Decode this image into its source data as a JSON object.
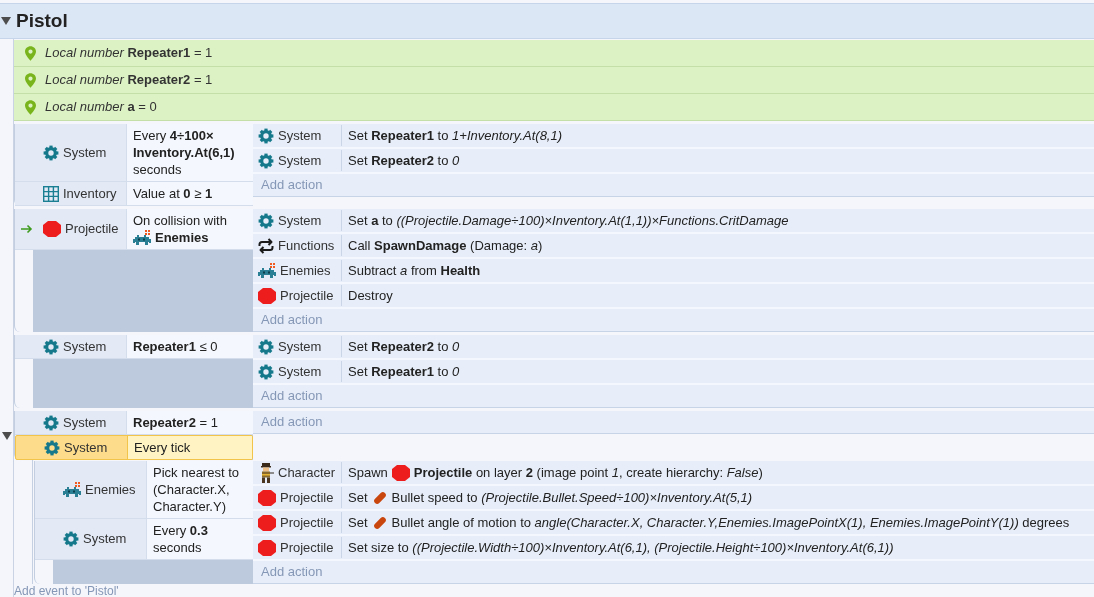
{
  "group": {
    "title": "Pistol",
    "expanded": true,
    "add_event_label": "Add event to 'Pistol'"
  },
  "local_variables": [
    {
      "text": "*Local number* **Repeater1** = 1"
    },
    {
      "text": "*Local number* **Repeater2** = 1"
    },
    {
      "text": "*Local number* **a** = 0"
    }
  ],
  "events": [
    {
      "conditions": [
        {
          "kind": "system",
          "object": "System",
          "trigger": false,
          "selected": false,
          "text": "Every **4÷100× Inventory.At(6,1)** seconds"
        },
        {
          "kind": "array",
          "object": "Inventory",
          "trigger": false,
          "selected": false,
          "text": "Value at **0** ≥ **1**"
        }
      ],
      "actions": [
        {
          "kind": "system",
          "object": "System",
          "text": "Set **Repeater1** to *1+Inventory.At(8,1)*"
        },
        {
          "kind": "system",
          "object": "System",
          "text": "Set **Repeater2** to *0*"
        }
      ],
      "add_action_label": "Add action"
    },
    {
      "conditions": [
        {
          "kind": "projectile",
          "object": "Projectile",
          "trigger": true,
          "selected": false,
          "parts": [
            {
              "kind": "text",
              "text": "On collision with"
            },
            {
              "kind": "enemy"
            },
            {
              "kind": "text",
              "text": "**Enemies**"
            }
          ]
        }
      ],
      "actions": [
        {
          "kind": "system",
          "object": "System",
          "text": "Set **a** to *((Projectile.Damage÷100)×Inventory.At(1,1))×Functions.CritDamage*"
        },
        {
          "kind": "function",
          "object": "Functions",
          "text": "Call **SpawnDamage** (Damage: *a*)"
        },
        {
          "kind": "enemy",
          "object": "Enemies",
          "text": "Subtract *a* from **Health**"
        },
        {
          "kind": "projectile",
          "object": "Projectile",
          "text": "Destroy"
        }
      ],
      "add_action_label": "Add action"
    },
    {
      "conditions": [
        {
          "kind": "system",
          "object": "System",
          "trigger": false,
          "selected": false,
          "text": "**Repeater1** ≤ 0"
        }
      ],
      "actions": [
        {
          "kind": "system",
          "object": "System",
          "text": "Set **Repeater2** to *0*"
        },
        {
          "kind": "system",
          "object": "System",
          "text": "Set **Repeater1** to *0*"
        }
      ],
      "add_action_label": "Add action"
    },
    {
      "expanded": true,
      "conditions": [
        {
          "kind": "system",
          "object": "System",
          "trigger": false,
          "selected": false,
          "text": "**Repeater2** = 1"
        },
        {
          "kind": "system",
          "object": "System",
          "trigger": false,
          "selected": true,
          "text": "Every tick"
        }
      ],
      "add_action_label": "Add action",
      "sub_events": [
        {
          "conditions": [
            {
              "kind": "enemy",
              "object": "Enemies",
              "trigger": false,
              "selected": false,
              "text": "Pick nearest to (Character.X, Character.Y)"
            },
            {
              "kind": "system",
              "object": "System",
              "trigger": false,
              "selected": false,
              "text": "Every **0.3** seconds"
            }
          ],
          "actions": [
            {
              "kind": "character",
              "object": "Character",
              "parts": [
                {
                  "kind": "text",
                  "text": "Spawn"
                },
                {
                  "kind": "projectile"
                },
                {
                  "kind": "text",
                  "text": "**Projectile** on layer **2** (image point *1*, create hierarchy: *False*)"
                }
              ]
            },
            {
              "kind": "projectile",
              "object": "Projectile",
              "parts": [
                {
                  "kind": "text",
                  "text": "Set"
                },
                {
                  "kind": "bullet"
                },
                {
                  "kind": "text",
                  "text": "Bullet speed to *(Projectile.Bullet.Speed÷100)×Inventory.At(5,1)*"
                }
              ]
            },
            {
              "kind": "projectile",
              "object": "Projectile",
              "parts": [
                {
                  "kind": "text",
                  "text": "Set"
                },
                {
                  "kind": "bullet"
                },
                {
                  "kind": "text",
                  "text": "Bullet angle of motion to *angle(Character.X, Character.Y,Enemies.ImagePointX(1), Enemies.ImagePointY(1))* degrees"
                }
              ]
            },
            {
              "kind": "projectile",
              "object": "Projectile",
              "text": "Set size to *((Projectile.Width÷100)×Inventory.At(6,1), (Projectile.Height÷100)×Inventory.At(6,1))*"
            }
          ],
          "add_action_label": "Add action"
        }
      ]
    }
  ]
}
